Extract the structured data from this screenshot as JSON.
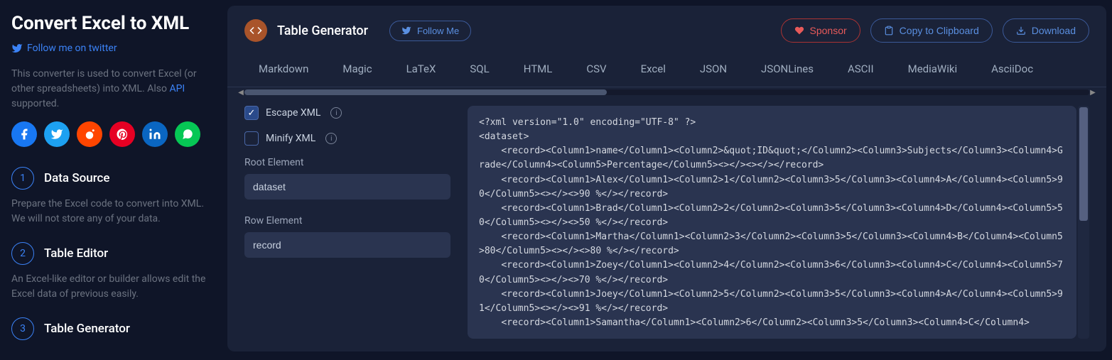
{
  "sidebar": {
    "title": "Convert Excel to XML",
    "twitter": "Follow me on twitter",
    "desc_pre": "This converter is used to convert Excel (or other spreadsheets) into XML. Also ",
    "api": "API",
    "desc_post": " supported.",
    "steps": [
      {
        "num": "1",
        "title": "Data Source",
        "desc": "Prepare the Excel code to convert into XML. We will not store any of your data."
      },
      {
        "num": "2",
        "title": "Table Editor",
        "desc": "An Excel-like editor or builder allows edit the Excel data of previous easily."
      },
      {
        "num": "3",
        "title": "Table Generator",
        "desc": ""
      }
    ]
  },
  "header": {
    "title": "Table Generator",
    "follow": "Follow Me",
    "sponsor": "Sponsor",
    "copy": "Copy to Clipboard",
    "download": "Download"
  },
  "tabs": [
    "Markdown",
    "Magic",
    "LaTeX",
    "SQL",
    "HTML",
    "CSV",
    "Excel",
    "JSON",
    "JSONLines",
    "ASCII",
    "MediaWiki",
    "AsciiDoc"
  ],
  "options": {
    "escape": {
      "label": "Escape XML",
      "checked": true
    },
    "minify": {
      "label": "Minify XML",
      "checked": false
    },
    "root_label": "Root Element",
    "root_value": "dataset",
    "row_label": "Row Element",
    "row_value": "record"
  },
  "chart_data": {
    "type": "table",
    "columns": [
      "name",
      "\"ID\"",
      "Subjects",
      "Grade",
      "Percentage"
    ],
    "rows": [
      [
        "Alex",
        1,
        5,
        "A",
        90
      ],
      [
        "Brad",
        2,
        5,
        "D",
        50
      ],
      [
        "Martha",
        3,
        5,
        "B",
        80
      ],
      [
        "Zoey",
        4,
        6,
        "C",
        70
      ],
      [
        "Joey",
        5,
        5,
        "A",
        91
      ],
      [
        "Samantha",
        6,
        5,
        "C",
        null
      ]
    ]
  },
  "code": "<?xml version=\"1.0\" encoding=\"UTF-8\" ?>\n<dataset>\n    <record><Column1>name</Column1><Column2>&quot;ID&quot;</Column2><Column3>Subjects</Column3><Column4>Grade</Column4><Column5>Percentage</Column5><></><></></record>\n    <record><Column1>Alex</Column1><Column2>1</Column2><Column3>5</Column3><Column4>A</Column4><Column5>90</Column5><></><>90 %</></record>\n    <record><Column1>Brad</Column1><Column2>2</Column2><Column3>5</Column3><Column4>D</Column4><Column5>50</Column5><></><>50 %</></record>\n    <record><Column1>Martha</Column1><Column2>3</Column2><Column3>5</Column3><Column4>B</Column4><Column5>80</Column5><></><>80 %</></record>\n    <record><Column1>Zoey</Column1><Column2>4</Column2><Column3>6</Column3><Column4>C</Column4><Column5>70</Column5><></><>70 %</></record>\n    <record><Column1>Joey</Column1><Column2>5</Column2><Column3>5</Column3><Column4>A</Column4><Column5>91</Column5><></><>91 %</></record>\n    <record><Column1>Samantha</Column1><Column2>6</Column2><Column3>5</Column3><Column4>C</Column4>"
}
